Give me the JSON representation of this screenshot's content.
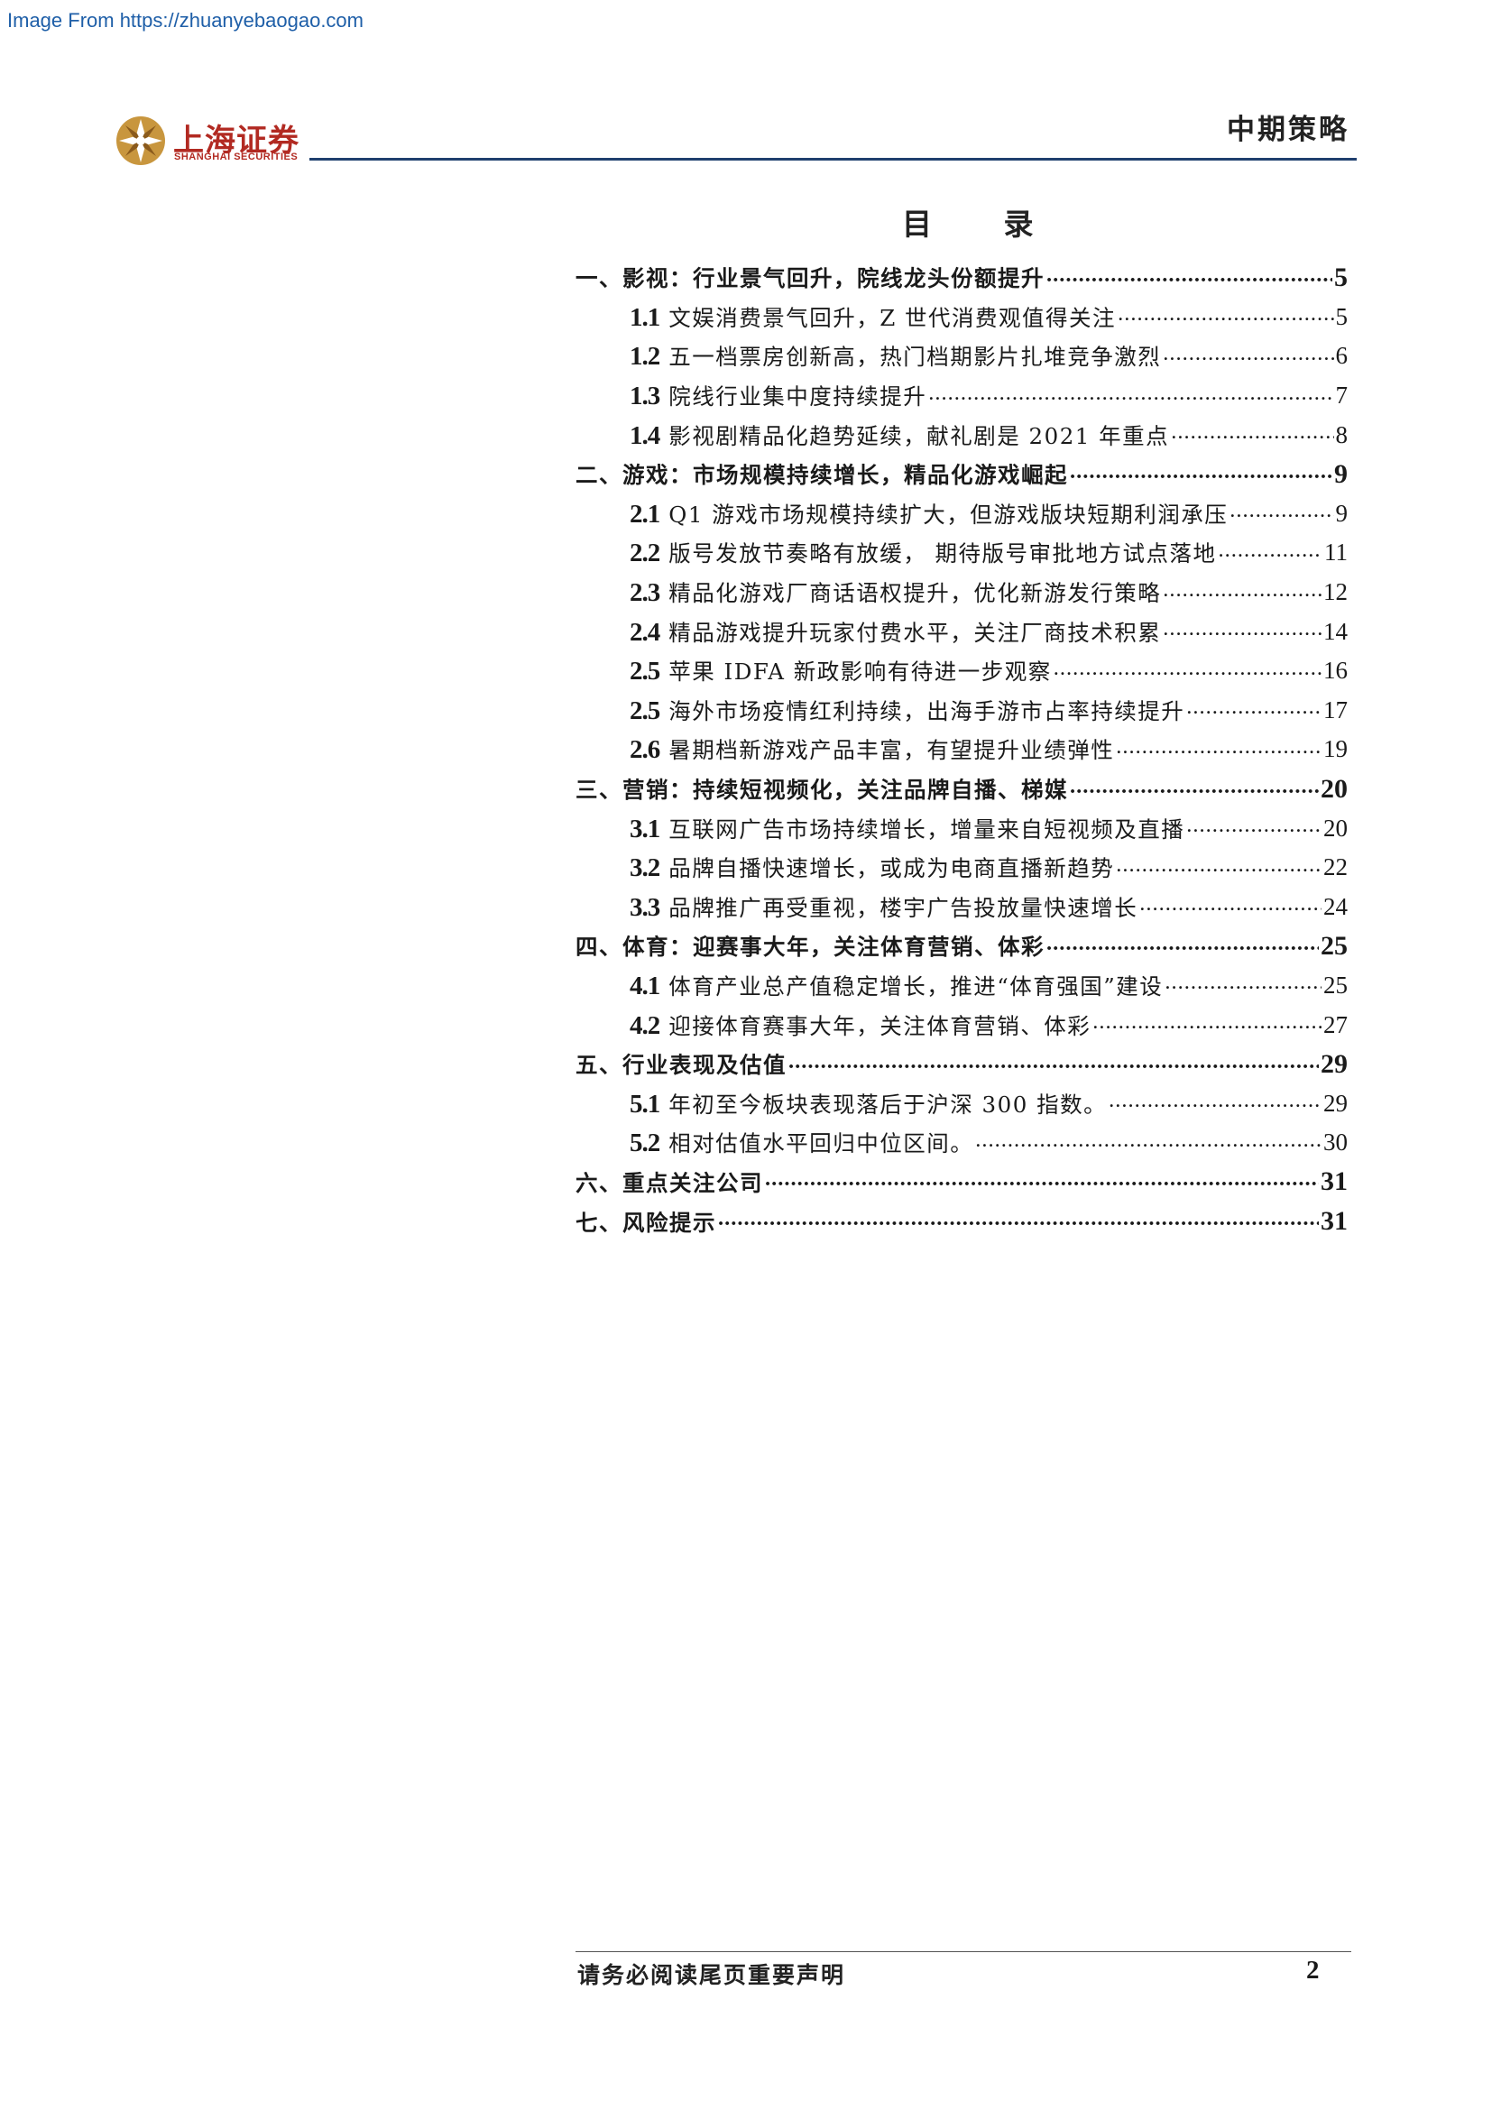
{
  "watermark": "Image From https://zhuanyebaogao.com",
  "logo": {
    "name_cn": "上海证券",
    "name_en": "SHANGHAI SECURITIES"
  },
  "header": {
    "title": "中期策略"
  },
  "toc": {
    "title": "目 录",
    "entries": [
      {
        "level": 1,
        "num": "",
        "text": "一、影视：行业景气回升，院线龙头份额提升",
        "page": "5"
      },
      {
        "level": 2,
        "num": "1.1",
        "text": "文娱消费景气回升，Z 世代消费观值得关注",
        "page": "5"
      },
      {
        "level": 2,
        "num": "1.2",
        "text": "五一档票房创新高，热门档期影片扎堆竞争激烈",
        "page": "6"
      },
      {
        "level": 2,
        "num": "1.3",
        "text": "院线行业集中度持续提升",
        "page": "7"
      },
      {
        "level": 2,
        "num": "1.4",
        "text": "影视剧精品化趋势延续，献礼剧是 2021 年重点",
        "page": "8"
      },
      {
        "level": 1,
        "num": "",
        "text": "二、游戏：市场规模持续增长，精品化游戏崛起",
        "page": "9"
      },
      {
        "level": 2,
        "num": "2.1",
        "text": "Q1 游戏市场规模持续扩大，但游戏版块短期利润承压",
        "page": "9"
      },
      {
        "level": 2,
        "num": "2.2",
        "text": "版号发放节奏略有放缓， 期待版号审批地方试点落地",
        "page": "11"
      },
      {
        "level": 2,
        "num": "2.3",
        "text": "精品化游戏厂商话语权提升，优化新游发行策略",
        "page": "12"
      },
      {
        "level": 2,
        "num": "2.4",
        "text": "精品游戏提升玩家付费水平，关注厂商技术积累",
        "page": "14"
      },
      {
        "level": 2,
        "num": "2.5",
        "text": "苹果 IDFA 新政影响有待进一步观察",
        "page": "16"
      },
      {
        "level": 2,
        "num": "2.5",
        "text": "海外市场疫情红利持续，出海手游市占率持续提升",
        "page": "17"
      },
      {
        "level": 2,
        "num": "2.6",
        "text": "暑期档新游戏产品丰富，有望提升业绩弹性",
        "page": "19"
      },
      {
        "level": 1,
        "num": "",
        "text": "三、营销：持续短视频化，关注品牌自播、梯媒",
        "page": "20"
      },
      {
        "level": 2,
        "num": "3.1",
        "text": "互联网广告市场持续增长，增量来自短视频及直播",
        "page": "20"
      },
      {
        "level": 2,
        "num": "3.2",
        "text": "品牌自播快速增长，或成为电商直播新趋势",
        "page": "22"
      },
      {
        "level": 2,
        "num": "3.3",
        "text": "品牌推广再受重视，楼宇广告投放量快速增长",
        "page": "24"
      },
      {
        "level": 1,
        "num": "",
        "text": "四、体育：迎赛事大年，关注体育营销、体彩",
        "page": "25"
      },
      {
        "level": 2,
        "num": "4.1",
        "text": "体育产业总产值稳定增长，推进“体育强国”建设",
        "page": "25"
      },
      {
        "level": 2,
        "num": "4.2",
        "text": "迎接体育赛事大年，关注体育营销、体彩",
        "page": "27"
      },
      {
        "level": 1,
        "num": "",
        "text": "五、行业表现及估值",
        "page": "29"
      },
      {
        "level": 2,
        "num": "5.1",
        "text": "年初至今板块表现落后于沪深 300 指数。",
        "page": "29"
      },
      {
        "level": 2,
        "num": "5.2",
        "text": "相对估值水平回归中位区间。",
        "page": "30"
      },
      {
        "level": 1,
        "num": "",
        "text": "六、重点关注公司",
        "page": "31"
      },
      {
        "level": 1,
        "num": "",
        "text": "七、风险提示",
        "page": "31"
      }
    ]
  },
  "footer": {
    "notice": "请务必阅读尾页重要声明",
    "page_number": "2"
  },
  "colors": {
    "brand_red": "#b22a22",
    "logo_gold": "#c8963e",
    "rule_blue": "#1f3f6e",
    "watermark_blue": "#1f5fa8"
  }
}
